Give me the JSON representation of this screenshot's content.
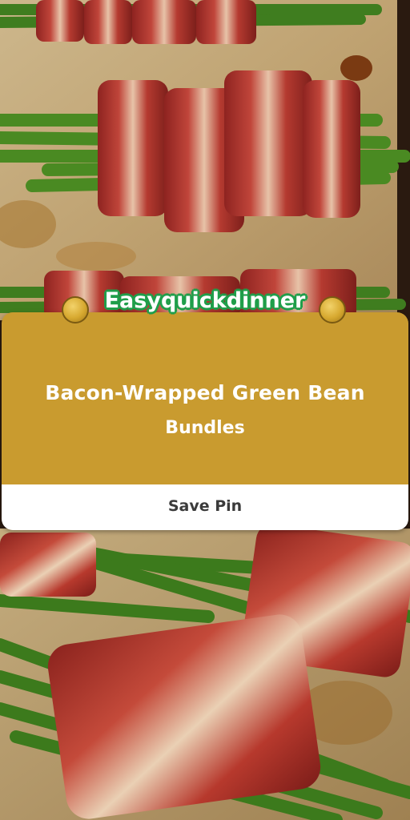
{
  "brand": {
    "name": "Easyquickdinner"
  },
  "recipe": {
    "title_line1": "Bacon-Wrapped Green Bean",
    "title_line2": "Bundles"
  },
  "actions": {
    "save_label": "Save Pin"
  },
  "colors": {
    "card_gold": "#c99b2f",
    "brand_green": "#1f9e4a",
    "parchment": "#c9b48a",
    "bacon": "#a8302a",
    "green_bean": "#3f7d1f"
  },
  "images": {
    "top_photo": "bacon-wrapped-green-beans-photo",
    "bottom_photo": "bacon-wrapped-green-beans-photo"
  }
}
